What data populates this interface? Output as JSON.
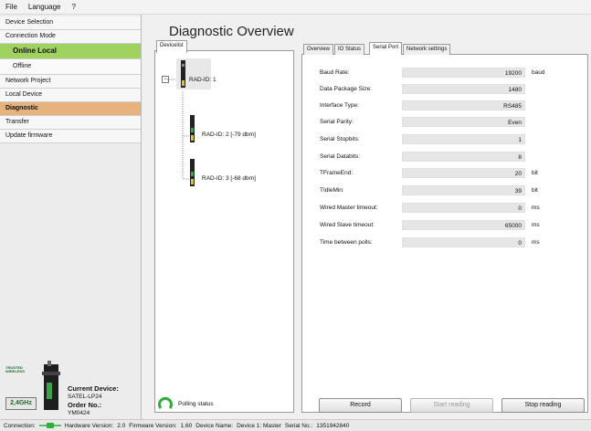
{
  "menu": {
    "items": [
      "File",
      "Language",
      "?"
    ]
  },
  "sidebar": {
    "items": [
      {
        "label": "Device Selection",
        "style": "normal"
      },
      {
        "label": "Connection Mode",
        "style": "normal"
      },
      {
        "label": "Online Local",
        "style": "active-green"
      },
      {
        "label": "Offline",
        "style": "sub"
      },
      {
        "label": "Network Project",
        "style": "normal"
      },
      {
        "label": "Local Device",
        "style": "normal"
      },
      {
        "label": "Diagnostic",
        "style": "active-orange"
      },
      {
        "label": "Transfer",
        "style": "normal"
      },
      {
        "label": "Update firmware",
        "style": "normal"
      }
    ],
    "device": {
      "current_label": "Current Device:",
      "current_value": "SATEL-LP24",
      "order_label": "Order No.:",
      "order_value": "YM0424",
      "freq_badge": "2,4GHz",
      "logo_text": "TRUSTED WIRELESS"
    }
  },
  "main": {
    "title": "Diagnostic Overview",
    "devicelist_tab": "Devicelist",
    "tree": {
      "root": "RAD-ID: 1",
      "children": [
        "RAD-ID: 2 [-79 dbm]",
        "RAD-ID: 3 [-68 dbm]"
      ]
    },
    "tabs": [
      "Overview",
      "IO Status",
      "Serial Port",
      "Network settings"
    ],
    "active_tab": 2,
    "fields": [
      {
        "label": "Baud Rate:",
        "value": "19200",
        "unit": "baud"
      },
      {
        "label": "Data Package Size:",
        "value": "1480",
        "unit": ""
      },
      {
        "label": "Interface Type:",
        "value": "RS485",
        "unit": ""
      },
      {
        "label": "Serial Parity:",
        "value": "Even",
        "unit": ""
      },
      {
        "label": "Serial Stopbits:",
        "value": "1",
        "unit": ""
      },
      {
        "label": "Serial Databits:",
        "value": "8",
        "unit": ""
      },
      {
        "label": "TFrameEnd:",
        "value": "20",
        "unit": "bit"
      },
      {
        "label": "TIdleMin:",
        "value": "39",
        "unit": "bit"
      },
      {
        "label": "Wired Master timeout:",
        "value": "0",
        "unit": "ms"
      },
      {
        "label": "Wired Slave timeout:",
        "value": "65000",
        "unit": "ms"
      },
      {
        "label": "Time between polls:",
        "value": "0",
        "unit": "ms"
      }
    ],
    "polling_status": "Polling status",
    "buttons": {
      "record": "Record",
      "start": "Start reading",
      "stop": "Stop reading"
    }
  },
  "status": {
    "connection_label": "Connection:",
    "hardware_label": "Hardware Version:",
    "hardware_value": "2.0",
    "firmware_label": "Firmware Version:",
    "firmware_value": "1.60",
    "device_name_label": "Device Name:",
    "device_name_value": "Device 1: Master",
    "serial_label": "Serial No.:",
    "serial_value": "1351942840"
  },
  "colors": {
    "online_green": "#9fd25e",
    "diagnostic_orange": "#e8b27c",
    "signal_green": "#2fae3a",
    "brand_dark_green": "#1e6a2e"
  }
}
